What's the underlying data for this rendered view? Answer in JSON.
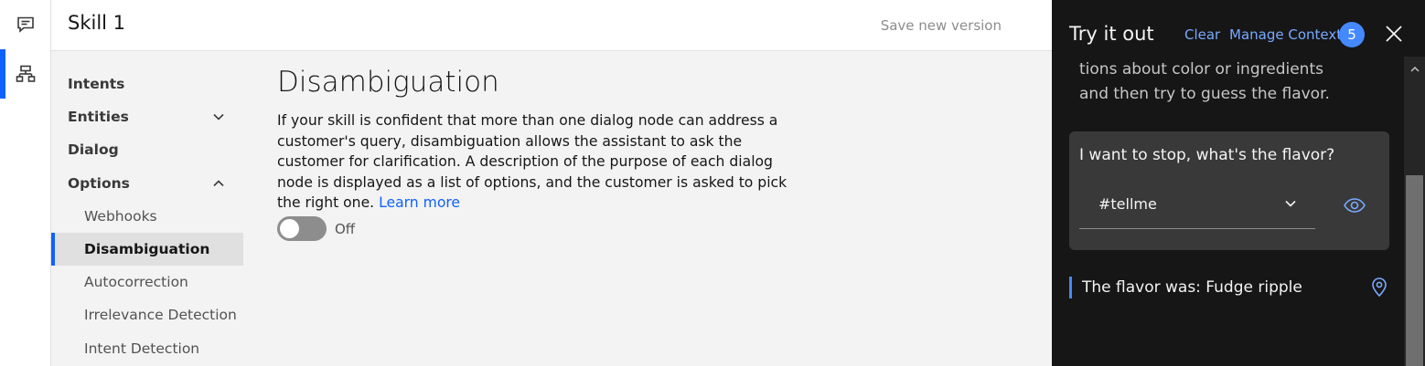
{
  "header": {
    "title": "Skill 1",
    "save_label": "Save new version"
  },
  "rail": {
    "items": [
      {
        "icon": "chat-icon"
      },
      {
        "icon": "skill-tree-icon",
        "active": true
      }
    ]
  },
  "nav": {
    "intents": "Intents",
    "entities": "Entities",
    "dialog": "Dialog",
    "options": "Options",
    "sub": {
      "webhooks": "Webhooks",
      "disambiguation": "Disambiguation",
      "autocorrection": "Autocorrection",
      "irrelevance": "Irrelevance Detection",
      "intent_detection": "Intent Detection"
    }
  },
  "main": {
    "title": "Disambiguation",
    "description": "If your skill is confident that more than one dialog node can address a customer's query, disambiguation allows the assistant to ask the customer for clarification. A description of the purpose of each dialog node is displayed as a list of options, and the customer is asked to pick the right one.",
    "learn_more": "Learn more",
    "toggle_state": "Off"
  },
  "panel": {
    "title": "Try it out",
    "clear": "Clear",
    "manage_context": "Manage Context",
    "context_count": "5",
    "previous_message": "tions about color or ingredients and then try to guess the flavor.",
    "user_message": "I want to stop, what's the flavor?",
    "intent": "#tellme",
    "bot_reply": "The flavor was: Fudge ripple"
  },
  "colors": {
    "accent": "#0f62fe",
    "link_dark": "#78a9ff",
    "panel_bg": "#161616",
    "card_bg": "#393939"
  }
}
